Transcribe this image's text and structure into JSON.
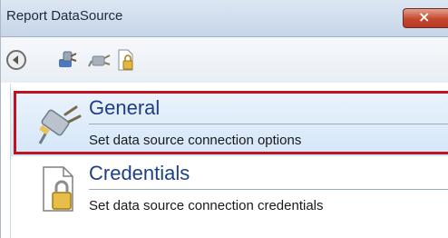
{
  "window": {
    "title": "Report DataSource",
    "close_glyph": "×"
  },
  "toolbar": {
    "buttons": [
      {
        "icon": "back-arrow-icon"
      },
      {
        "icon": "general-plug-icon"
      },
      {
        "icon": "plug-gray-icon"
      },
      {
        "icon": "credentials-lock-icon"
      }
    ]
  },
  "nav": {
    "items": [
      {
        "title": "General",
        "description": "Set data source connection options",
        "icon": "plug-icon",
        "selected": true
      },
      {
        "title": "Credentials",
        "description": "Set data source connection credentials",
        "icon": "lock-document-icon",
        "selected": false
      }
    ]
  },
  "colors": {
    "accent": "#1d3f84",
    "highlight_border": "#c1121f",
    "selection_bg": "#d4e6f8"
  }
}
